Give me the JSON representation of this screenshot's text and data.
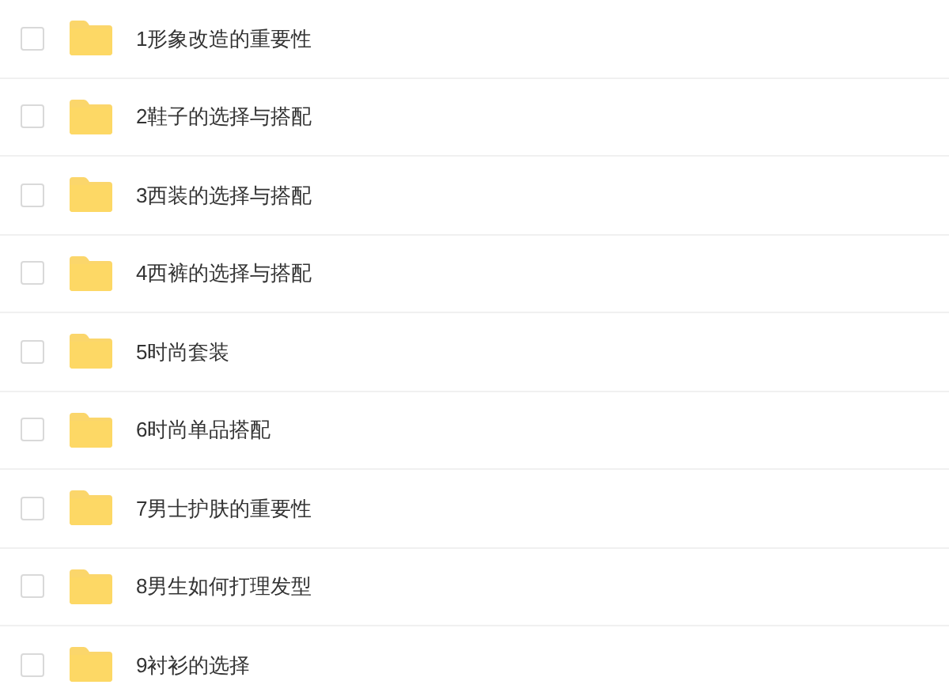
{
  "files": [
    {
      "name": "1形象改造的重要性",
      "checked": false
    },
    {
      "name": "2鞋子的选择与搭配",
      "checked": false
    },
    {
      "name": "3西装的选择与搭配",
      "checked": false
    },
    {
      "name": "4西裤的选择与搭配",
      "checked": false
    },
    {
      "name": "5时尚套装",
      "checked": false
    },
    {
      "name": "6时尚单品搭配",
      "checked": false
    },
    {
      "name": "7男士护肤的重要性",
      "checked": false
    },
    {
      "name": "8男生如何打理发型",
      "checked": false
    },
    {
      "name": "9衬衫的选择",
      "checked": false
    }
  ]
}
